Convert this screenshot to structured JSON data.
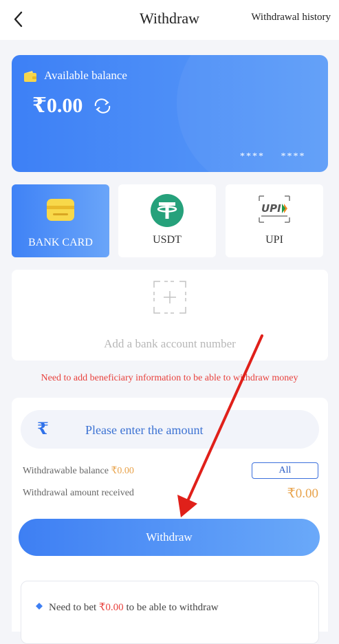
{
  "header": {
    "title": "Withdraw",
    "history_label": "Withdrawal history"
  },
  "balance_card": {
    "label": "Available balance",
    "amount": "₹0.00",
    "card_mask": "**** ****"
  },
  "methods": [
    {
      "label": "BANK CARD",
      "icon": "bank-card-icon",
      "active": true
    },
    {
      "label": "USDT",
      "icon": "usdt-tether-icon",
      "active": false
    },
    {
      "label": "UPI",
      "icon": "upi-logo-icon",
      "active": false
    }
  ],
  "add_account": {
    "label": "Add a bank account number"
  },
  "warning": "Need to add beneficiary information to be able to withdraw money",
  "amount_panel": {
    "currency_symbol": "₹",
    "placeholder": "Please enter the amount",
    "withdrawable_label": "Withdrawable balance",
    "withdrawable_value": "₹0.00",
    "all_label": "All",
    "received_label": "Withdrawal amount received",
    "received_value": "₹0.00",
    "withdraw_button": "Withdraw"
  },
  "notes": {
    "prefix": "Need to bet",
    "amount": "₹0.00",
    "suffix": "to be able to withdraw"
  },
  "colors": {
    "accent": "#3e7ff3",
    "warning": "#e8403c",
    "amount": "#e8a24a",
    "usdt": "#26a17b"
  }
}
